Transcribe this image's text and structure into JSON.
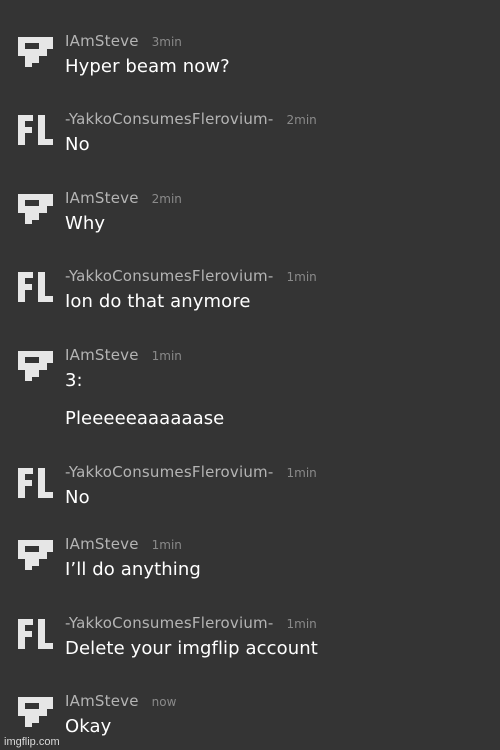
{
  "users": {
    "steve": {
      "name": "IAmSteve",
      "avatar_icon": "steve-pixel-logo"
    },
    "yakko": {
      "name": "-YakkoConsumesFlerovium-",
      "avatar_icon": "fl-logo",
      "avatar_text": "FL"
    }
  },
  "messages": [
    {
      "user": "IAmSteve",
      "time": "3min",
      "lines": [
        "Hyper beam now?"
      ]
    },
    {
      "user": "-YakkoConsumesFlerovium-",
      "time": "2min",
      "lines": [
        "No"
      ]
    },
    {
      "user": "IAmSteve",
      "time": "2min",
      "lines": [
        "Why"
      ]
    },
    {
      "user": "-YakkoConsumesFlerovium-",
      "time": "1min",
      "lines": [
        "Ion do that anymore"
      ]
    },
    {
      "user": "IAmSteve",
      "time": "1min",
      "lines": [
        "3:",
        "Pleeeeeaaaaaase"
      ]
    },
    {
      "user": "-YakkoConsumesFlerovium-",
      "time": "1min",
      "lines": [
        "No"
      ]
    },
    {
      "user": "IAmSteve",
      "time": "1min",
      "lines": [
        "I’ll do anything"
      ]
    },
    {
      "user": "-YakkoConsumesFlerovium-",
      "time": "1min",
      "lines": [
        "Delete your imgflip account"
      ]
    },
    {
      "user": "IAmSteve",
      "time": "now",
      "lines": [
        "Okay"
      ]
    }
  ],
  "watermark": "imgflip.com",
  "colors": {
    "background": "#343434",
    "avatar": "#e6e6e6",
    "username": "#b4b4b4",
    "timestamp": "#8a8a8a",
    "message_text": "#ffffff"
  }
}
